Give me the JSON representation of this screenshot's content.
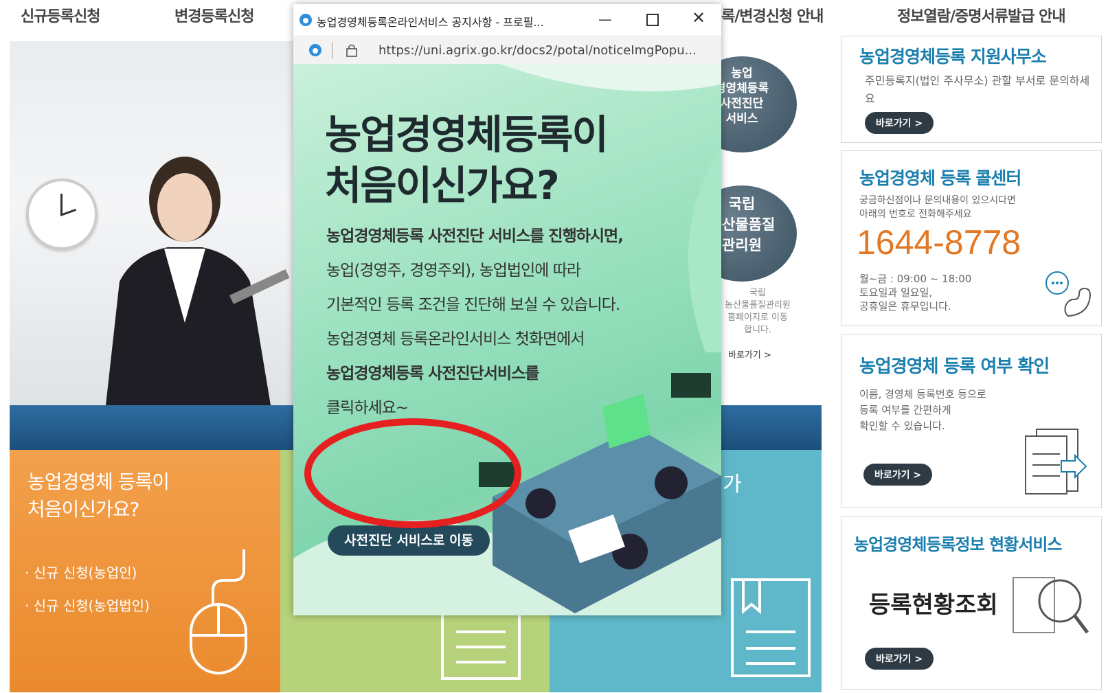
{
  "topnav": {
    "items": [
      "신규등록신청",
      "변경등록신청",
      "록/변경신청 안내",
      "정보열람/증명서류발급 안내"
    ]
  },
  "left_cards": {
    "orange_title_line1": "농업경영체 등록이",
    "orange_title_line2": "처음이신가요?",
    "orange_items": [
      "신규 신청(농업인)",
      "신규 신청(농업법인)"
    ],
    "teal_partial": "가"
  },
  "mid_strip": {
    "circle1": [
      "농업",
      "경영체등록",
      "사전진단",
      "서비스"
    ],
    "circle2": [
      "국립",
      "농산물품질",
      "관리원"
    ],
    "circle2_desc": [
      "국립",
      "농산물품질관리원",
      "홈페이지로 이동",
      "합니다."
    ],
    "goto_label": "바로가기 >"
  },
  "right_panels": {
    "office": {
      "title": "농업경영체등록 지원사무소",
      "desc": "주민등록지(법인 주사무소) 관할 부서로 문의하세요",
      "button": "바로가기  >"
    },
    "callcenter": {
      "title": "농업경영체 등록 콜센터",
      "desc_line1": "궁금하신점이나 문의내용이 있으시다면",
      "desc_line2": "아래의 번호로 전화해주세요",
      "phone": "1644-8778",
      "hours_line1": "월~금 : 09:00 ~ 18:00",
      "hours_line2": "토요일과 일요일,",
      "hours_line3": "공휴일은 휴무입니다."
    },
    "check": {
      "title": "농업경영체 등록 여부 확인",
      "desc_line1": "이름, 경영체 등록번호 등으로",
      "desc_line2": "등록 여부를 간편하게",
      "desc_line3": "확인할 수 있습니다.",
      "button": "바로가기  >"
    },
    "status": {
      "title": "농업경영체등록정보 현황서비스",
      "big_text": "등록현황조회",
      "button": "바로가기  >"
    }
  },
  "popup": {
    "window_title": "농업경영체등록온라인서비스 공지사항 - 프로필...",
    "url": "https://uni.agrix.go.kr/docs2/potal/noticeImgPopu...",
    "headline_line1": "농업경영체등록이",
    "headline_line2": "처음이신가요?",
    "body_lines": [
      "농업경영체등록 사전진단 서비스를 진행하시면,",
      "농업(경영주, 경영주외), 농업법인에 따라",
      "기본적인 등록 조건을 진단해 보실 수 있습니다.",
      "농업경영체 등록온라인서비스 첫화면에서",
      "농업경영체등록 사전진단서비스를",
      "클릭하세요~"
    ],
    "cta_label": "사전진단 서비스로 이동"
  },
  "colors": {
    "accent_blue": "#1a7fae",
    "orange": "#ea8a2d",
    "green": "#b6d27a",
    "teal": "#5fb8c9",
    "cta_dark": "#23495b",
    "annotation_red": "#e62020"
  }
}
